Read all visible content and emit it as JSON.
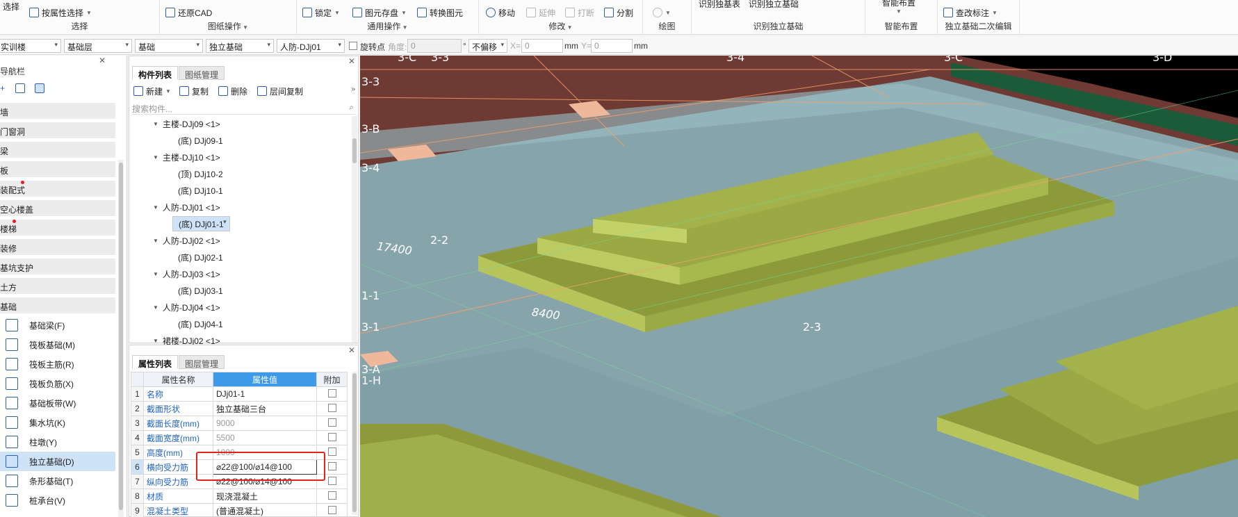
{
  "ribbon": {
    "groups": [
      {
        "name": "选择",
        "buttons": [
          "选择",
          "按属性选择"
        ]
      },
      {
        "name": "图纸操作",
        "buttons": [
          "还原CAD"
        ]
      },
      {
        "name": "通用操作",
        "buttons": [
          "锁定",
          "图元存盘",
          "转换图元"
        ]
      },
      {
        "name": "修改",
        "buttons": [
          "移动",
          "延伸",
          "打断",
          "分割"
        ]
      },
      {
        "name": "绘图",
        "buttons": []
      },
      {
        "name": "识别独立基础",
        "buttons": [
          "识别独基表",
          "识别独立基础"
        ]
      },
      {
        "name": "智能布置",
        "buttons": [
          "智能布置"
        ]
      },
      {
        "name": "独立基础二次编辑",
        "buttons": [
          "查改标注"
        ]
      }
    ]
  },
  "toolbar2": {
    "floor": "实训楼",
    "layer": "基础层",
    "category": "基础",
    "type": "独立基础",
    "component": "人防-DJj01",
    "rotate_label": "旋转点",
    "angle_label": "角度:",
    "angle_value": "0",
    "degree": "°",
    "offset": "不偏移",
    "x_label": "X=",
    "x_value": "0",
    "mm1": "mm",
    "y_label": "Y=",
    "y_value": "0",
    "mm2": "mm"
  },
  "nav": {
    "title": "导航栏",
    "categories": [
      "墙",
      "门窗洞",
      "梁",
      "板",
      "装配式",
      "空心楼盖",
      "楼梯",
      "装修",
      "基坑支护",
      "土方",
      "基础"
    ],
    "items": [
      "基础梁(F)",
      "筏板基础(M)",
      "筏板主筋(R)",
      "筏板负筋(X)",
      "基础板带(W)",
      "集水坑(K)",
      "柱墩(Y)",
      "独立基础(D)",
      "条形基础(T)",
      "桩承台(V)"
    ]
  },
  "complist": {
    "tabs": [
      "构件列表",
      "图纸管理"
    ],
    "tools": [
      "新建",
      "复制",
      "删除",
      "层间复制"
    ],
    "search_placeholder": "搜索构件...",
    "tree": [
      {
        "label": "主楼-DJj09 <1>",
        "level": 0
      },
      {
        "label": "(底) DJj09-1",
        "level": 1
      },
      {
        "label": "主楼-DJj10 <1>",
        "level": 0
      },
      {
        "label": "(顶) DJj10-2",
        "level": 1
      },
      {
        "label": "(底) DJj10-1",
        "level": 1
      },
      {
        "label": "人防-DJj01 <1>",
        "level": 0
      },
      {
        "label": "(底) DJj01-1",
        "level": 1,
        "selected": true
      },
      {
        "label": "人防-DJj02 <1>",
        "level": 0
      },
      {
        "label": "(底) DJj02-1",
        "level": 1
      },
      {
        "label": "人防-DJj03 <1>",
        "level": 0
      },
      {
        "label": "(底) DJj03-1",
        "level": 1
      },
      {
        "label": "人防-DJj04 <1>",
        "level": 0
      },
      {
        "label": "(底) DJj04-1",
        "level": 1
      },
      {
        "label": "裙楼-DJj02 <1>",
        "level": 0
      }
    ]
  },
  "props": {
    "tabs": [
      "属性列表",
      "图层管理"
    ],
    "headers": [
      "属性名称",
      "属性值",
      "附加"
    ],
    "rows": [
      {
        "idx": "1",
        "name": "名称",
        "value": "DJj01-1",
        "grey": false
      },
      {
        "idx": "2",
        "name": "截面形状",
        "value": "独立基础三台",
        "grey": false
      },
      {
        "idx": "3",
        "name": "截面长度(mm)",
        "value": "9000",
        "grey": true
      },
      {
        "idx": "4",
        "name": "截面宽度(mm)",
        "value": "5500",
        "grey": true
      },
      {
        "idx": "5",
        "name": "高度(mm)",
        "value": "1000",
        "grey": true
      },
      {
        "idx": "6",
        "name": "横向受力筋",
        "value": "⌀22@100/⌀14@100",
        "grey": false
      },
      {
        "idx": "7",
        "name": "纵向受力筋",
        "value": "⌀22@100/⌀14@100",
        "grey": false
      },
      {
        "idx": "8",
        "name": "材质",
        "value": "现浇混凝土",
        "grey": false
      },
      {
        "idx": "9",
        "name": "混凝土类型",
        "value": "(普通混凝土)",
        "grey": false
      }
    ]
  },
  "canvas": {
    "axes": [
      "3-C",
      "3-3",
      "3-4",
      "3-C",
      "3-D",
      "3-3",
      "3-B",
      "3-4",
      "2-2",
      "1-1",
      "3-1",
      "2-3",
      "3-A",
      "1-H"
    ],
    "dims": [
      "17400",
      "8400"
    ]
  },
  "colors": {
    "accent": "#3d9ae8",
    "highlight_box": "#e0241b",
    "foundation_top": "#a8b548",
    "slab": "#8fb7bd",
    "background": "#6e3a33"
  }
}
